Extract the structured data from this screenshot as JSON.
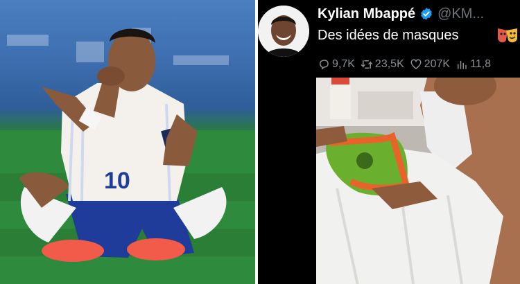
{
  "tweet": {
    "display_name": "Kylian Mbappé",
    "handle": "@KM...",
    "text": "Des idées de masques",
    "emoji_icon": "performing-arts-masks-icon",
    "stats": {
      "replies": "9,7K",
      "reposts": "23,5K",
      "likes": "207K",
      "views": "11,8"
    }
  },
  "photo": {
    "jersey_number": "10"
  },
  "colors": {
    "background": "#000000",
    "text": "#ffffff",
    "muted": "#71767b",
    "verified": "#1d9bf0",
    "pitch_green": "#2f8a3e",
    "board_blue": "#3f6fb0",
    "mask_green": "#6ab02e",
    "mask_orange": "#e8632a"
  }
}
